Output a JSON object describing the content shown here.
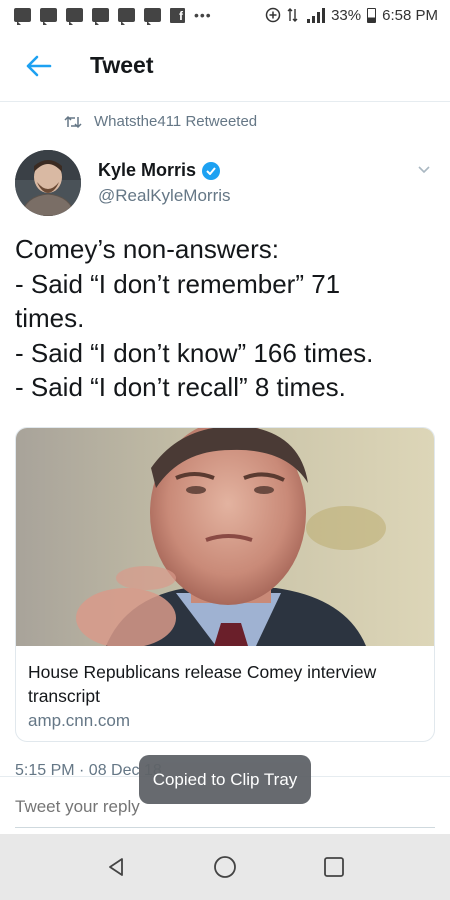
{
  "status_bar": {
    "battery": "33%",
    "time": "6:58 PM",
    "notification_icons": [
      "message-icon",
      "message-icon",
      "message-icon",
      "message-icon",
      "message-icon",
      "message-icon",
      "facebook-icon",
      "more-dots-icon"
    ],
    "dots": "•••"
  },
  "header": {
    "title": "Tweet"
  },
  "retweet_context": {
    "text": "Whatsthe411 Retweeted"
  },
  "author": {
    "name": "Kyle Morris",
    "handle": "@RealKyleMorris",
    "verified": true
  },
  "tweet": {
    "lines": [
      "Comey’s non-answers:",
      "- Said “I don’t remember” 71",
      "times.",
      "- Said “I don’t know” 166 times.",
      "- Said “I don’t recall” 8 times."
    ]
  },
  "link_card": {
    "title": "House Republicans release Comey interview transcript",
    "domain": "amp.cnn.com"
  },
  "timestamp": "5:15 PM · 08 Dec 18",
  "reply": {
    "placeholder": "Tweet your reply"
  },
  "toast": {
    "text": "Copied to Clip Tray"
  },
  "colors": {
    "accent": "#1da1f2",
    "secondary_text": "#657786",
    "toast_bg": "#5f6368",
    "nav_bg": "#e8e8e8"
  }
}
